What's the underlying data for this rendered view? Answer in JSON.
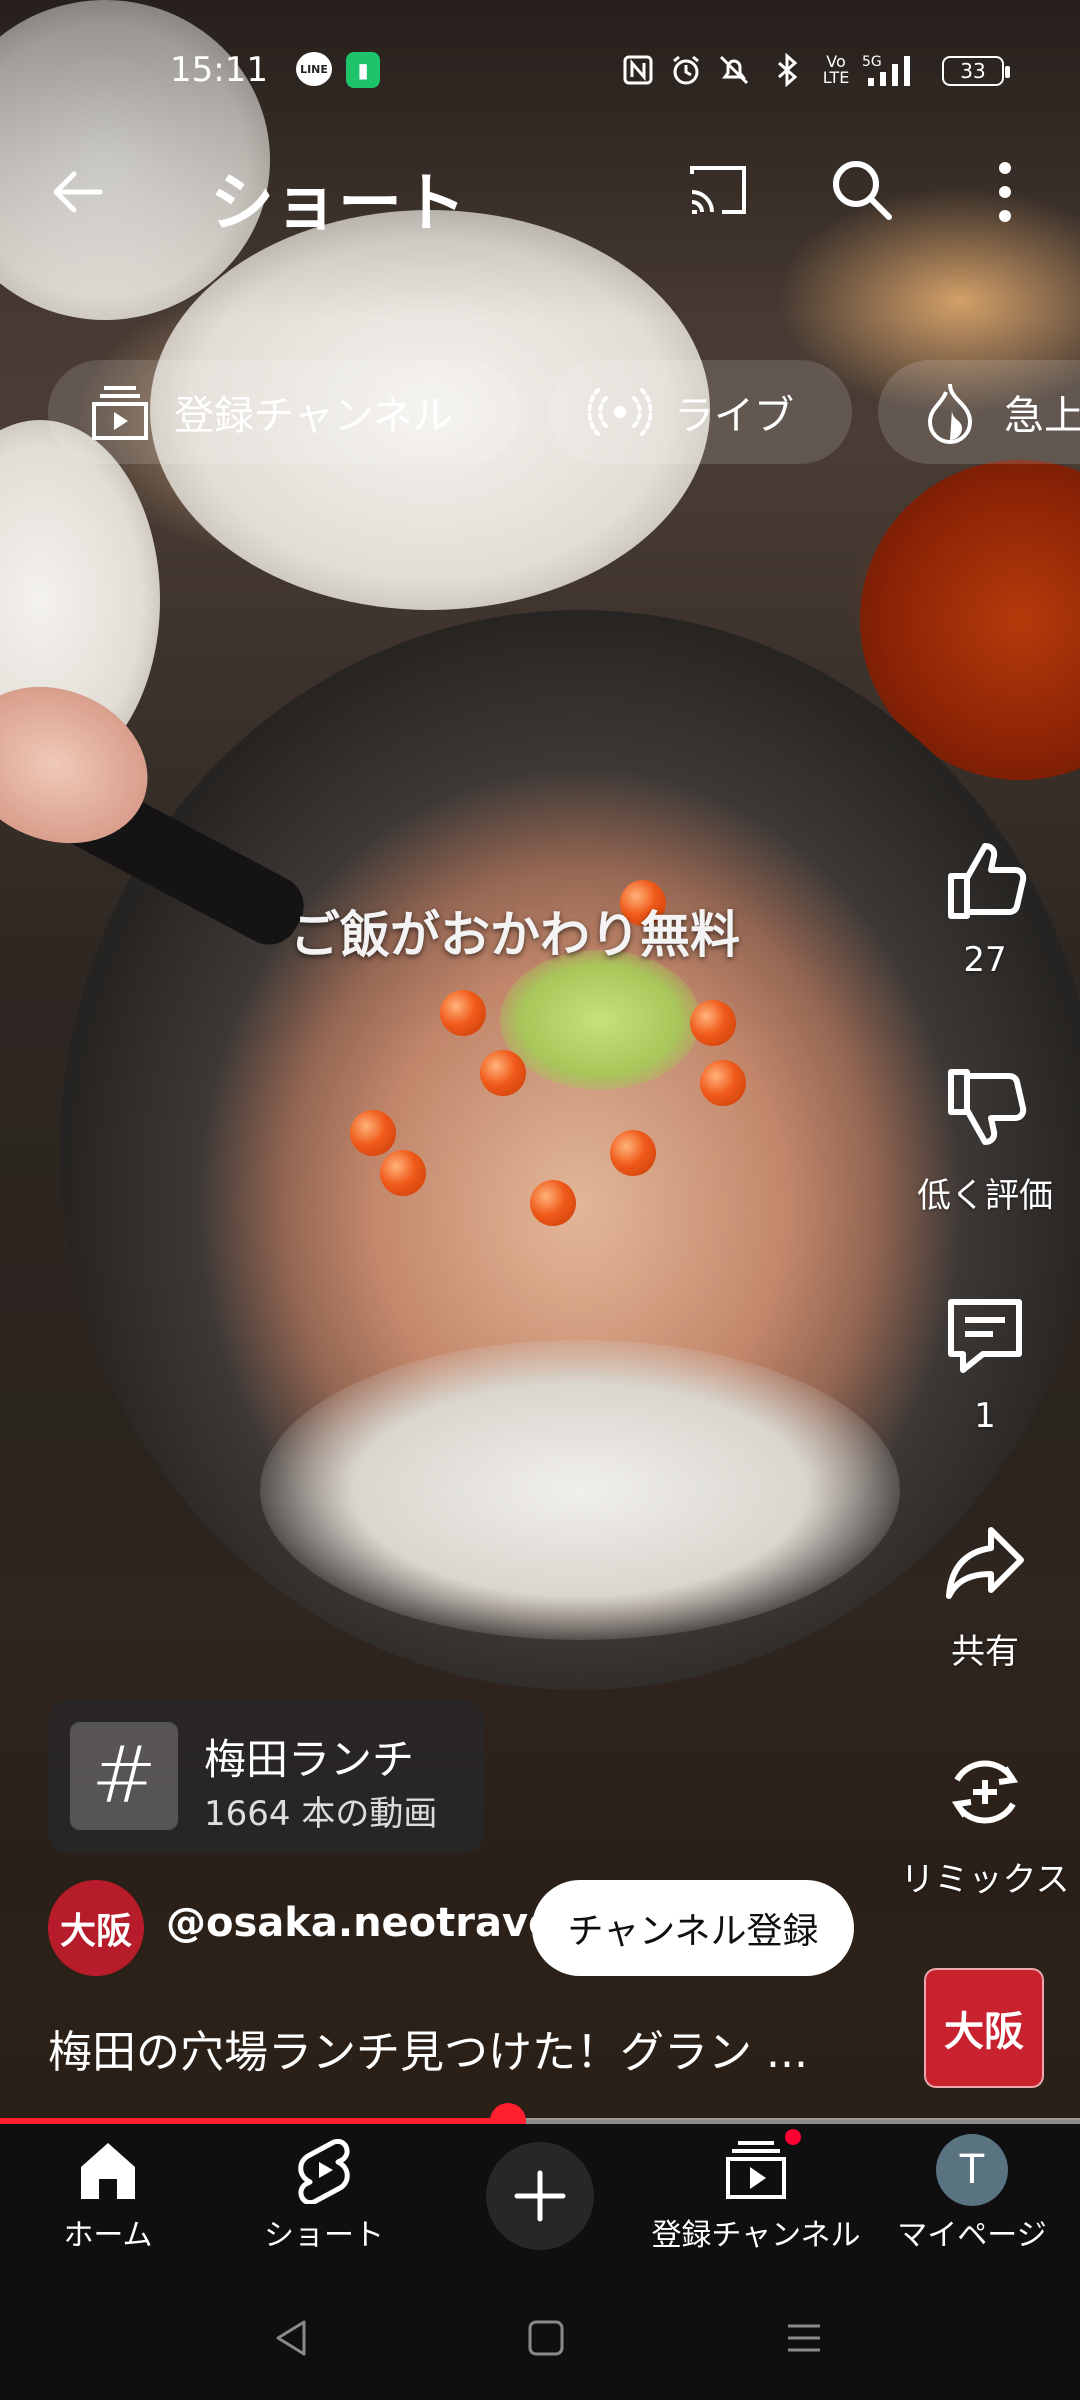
{
  "status_bar": {
    "time": "15:11",
    "battery": "33",
    "icons": [
      "line-icon",
      "battery-saver-icon",
      "nfc-icon",
      "alarm-icon",
      "mute-icon",
      "bluetooth-icon",
      "volte-icon",
      "5g-signal-icon",
      "battery-icon"
    ]
  },
  "header": {
    "title": "ショート",
    "icons": [
      "back-arrow-icon",
      "cast-icon",
      "search-icon",
      "more-vert-icon"
    ]
  },
  "chips": [
    {
      "label": "登録チャンネル",
      "icon": "subscriptions-icon"
    },
    {
      "label": "ライブ",
      "icon": "live-icon"
    },
    {
      "label": "急上",
      "icon": "trending-icon"
    }
  ],
  "video": {
    "overlay_caption": "ご飯がおかわり無料"
  },
  "actions": {
    "like_count": "27",
    "dislike_label": "低く評価",
    "comment_count": "1",
    "share_label": "共有",
    "remix_label": "リミックス"
  },
  "hashtag": {
    "symbol": "#",
    "name": "梅田ランチ",
    "count": "1664 本の動画"
  },
  "channel": {
    "avatar_text": "大阪",
    "handle": "@osaka.neotravel",
    "subscribe_label": "チャンネル登録"
  },
  "description": "梅田の穴場ランチ見つけた！グラン ...",
  "thumbnail_text": "大阪",
  "progress": 0.47,
  "colors": {
    "accent": "#ff1e2d",
    "nav_bg": "#0f0f0f",
    "battery_saver": "#1ec46a",
    "channel_red": "#b71c2a"
  },
  "bottom_nav": [
    {
      "label": "ホーム",
      "icon": "home-icon"
    },
    {
      "label": "ショート",
      "icon": "shorts-icon"
    },
    {
      "label": "",
      "icon": "create-plus-icon"
    },
    {
      "label": "登録チャンネル",
      "icon": "subscriptions-icon"
    },
    {
      "label": "マイページ",
      "icon": "profile-avatar",
      "avatar_letter": "T"
    }
  ],
  "system_nav": [
    "back-triangle-icon",
    "home-square-icon",
    "recents-menu-icon"
  ]
}
